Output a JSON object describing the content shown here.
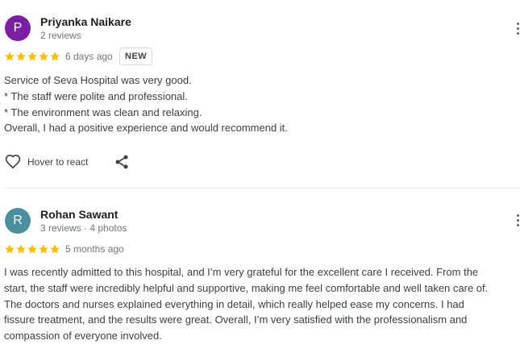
{
  "reviews": [
    {
      "avatar_letter": "P",
      "avatar_color": "#7b1fa2",
      "name": "Priyanka Naikare",
      "meta": "2 reviews",
      "rating": 5,
      "date": "6 days ago",
      "badge": "NEW",
      "lines": [
        "Service of Seva Hospital was very good.",
        "* The staff were polite and professional.",
        "* The environment was clean and relaxing.",
        "Overall, I had a positive experience and would recommend it."
      ],
      "react_label": "Hover to react"
    },
    {
      "avatar_letter": "R",
      "avatar_color": "#4a8fa0",
      "name": "Rohan Sawant",
      "meta": "3 reviews · 4 photos",
      "rating": 5,
      "date": "5 months ago",
      "lines": [
        "I was recently admitted to this hospital, and I’m very grateful for the excellent care I received. From the",
        "start, the staff were incredibly helpful and supportive, making me feel comfortable and well taken care of.",
        "The doctors and nurses explained everything in detail, which really helped ease my concerns. I had",
        "fissure treatment, and the results were great. Overall, I’m very satisfied with the professionalism and",
        "compassion of everyone involved."
      ]
    }
  ],
  "colors": {
    "star": "#fbbc04"
  },
  "icons": {
    "star": "star-icon",
    "menu": "more-vert-icon",
    "heart": "heart-outline-icon",
    "share": "share-icon"
  }
}
